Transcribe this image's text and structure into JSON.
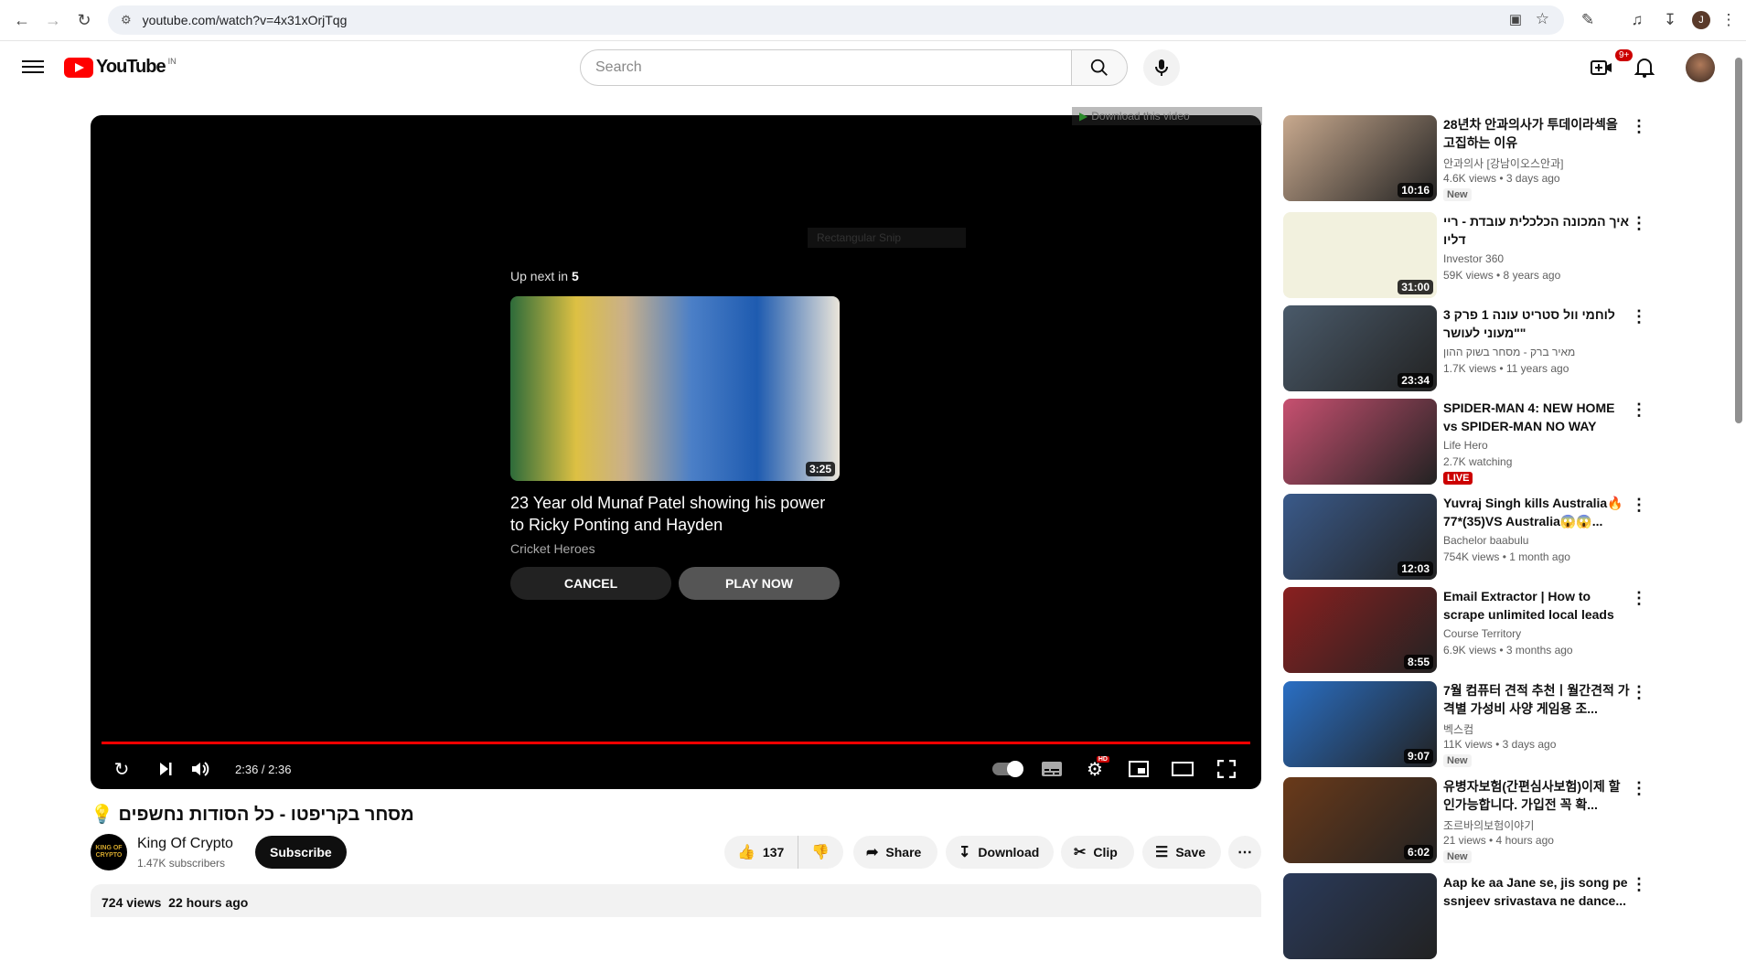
{
  "browser": {
    "url": "youtube.com/watch?v=4x31xOrjTqg",
    "profile_initial": "J"
  },
  "header": {
    "logo_text": "YouTube",
    "country_code": "IN",
    "search_placeholder": "Search",
    "notification_count": "9+"
  },
  "player": {
    "download_overlay": "Download this video",
    "snip_overlay": "Rectangular Snip",
    "up_next_label": "Up next in",
    "up_next_seconds": "5",
    "next_video": {
      "title": "23 Year old Munaf Patel showing his power to Ricky Ponting and Hayden",
      "channel": "Cricket Heroes",
      "duration": "3:25"
    },
    "cancel_label": "CANCEL",
    "play_now_label": "PLAY NOW",
    "time": "2:36 / 2:36",
    "progress_fraction": 1.0,
    "settings_badge": "HD"
  },
  "video": {
    "title": "מסחר בקריפטו - כל הסודות נחשפים 💡",
    "channel": "King Of Crypto",
    "channel_avatar_text": "KING OF CRYPTO",
    "subscribers": "1.47K subscribers",
    "subscribe_label": "Subscribe",
    "likes": "137",
    "share_label": "Share",
    "download_label": "Download",
    "clip_label": "Clip",
    "save_label": "Save",
    "views": "724 views",
    "age": "22 hours ago"
  },
  "recommendations": [
    {
      "title": "28년차 안과의사가 투데이라섹을 고집하는 이유",
      "channel": "안과의사 [강남이오스안과]",
      "meta": "4.6K views  • 3 days ago",
      "badge": "New",
      "duration": "10:16",
      "color": "#c8a98e"
    },
    {
      "title": "איך המכונה הכלכלית עובדת - ריי דליו",
      "channel": "Investor 360",
      "meta": "59K views  • 8 years ago",
      "badge": "",
      "duration": "31:00",
      "color": "#f2f1de"
    },
    {
      "title": "לוחמי וול סטריט עונה 1 פרק 3 \"מעוני לעושר\"",
      "channel": "מאיר ברק - מסחר בשוק ההון",
      "meta": "1.7K views  • 11 years ago",
      "badge": "",
      "duration": "23:34",
      "color": "#4a5a6a"
    },
    {
      "title": "SPIDER-MAN 4: NEW HOME vs SPIDER-MAN NO WAY HOME,...",
      "channel": "Life Hero",
      "meta": "2.7K watching",
      "badge": "LIVE",
      "duration": "",
      "color": "#c75070"
    },
    {
      "title": "Yuvraj Singh kills Australia🔥 77*(35)VS Australia😱😱...",
      "channel": "Bachelor baabulu",
      "meta": "754K views  • 1 month ago",
      "badge": "",
      "duration": "12:03",
      "color": "#3a5a8a"
    },
    {
      "title": "Email Extractor | How to scrape unlimited local leads from...",
      "channel": "Course Territory",
      "meta": "6.9K views  • 3 months ago",
      "badge": "",
      "duration": "8:55",
      "color": "#8a2020"
    },
    {
      "title": "7월 컴퓨터 견적 추천ㅣ월간견적 가격별 가성비 사양 게임용 조...",
      "channel": "벡스컴",
      "meta": "11K views  • 3 days ago",
      "badge": "New",
      "duration": "9:07",
      "color": "#2a6fc4"
    },
    {
      "title": "유병자보험(간편심사보험)이제 할인가능합니다. 가입전 꼭 확...",
      "channel": "조르바의보험이야기",
      "meta": "21 views  • 4 hours ago",
      "badge": "New",
      "duration": "6:02",
      "color": "#6a3a1a"
    },
    {
      "title": "Aap ke aa Jane se, jis song pe ssnjeev srivastava ne dance...",
      "channel": "",
      "meta": "",
      "badge": "",
      "duration": "",
      "color": "#2a3a5a"
    }
  ]
}
